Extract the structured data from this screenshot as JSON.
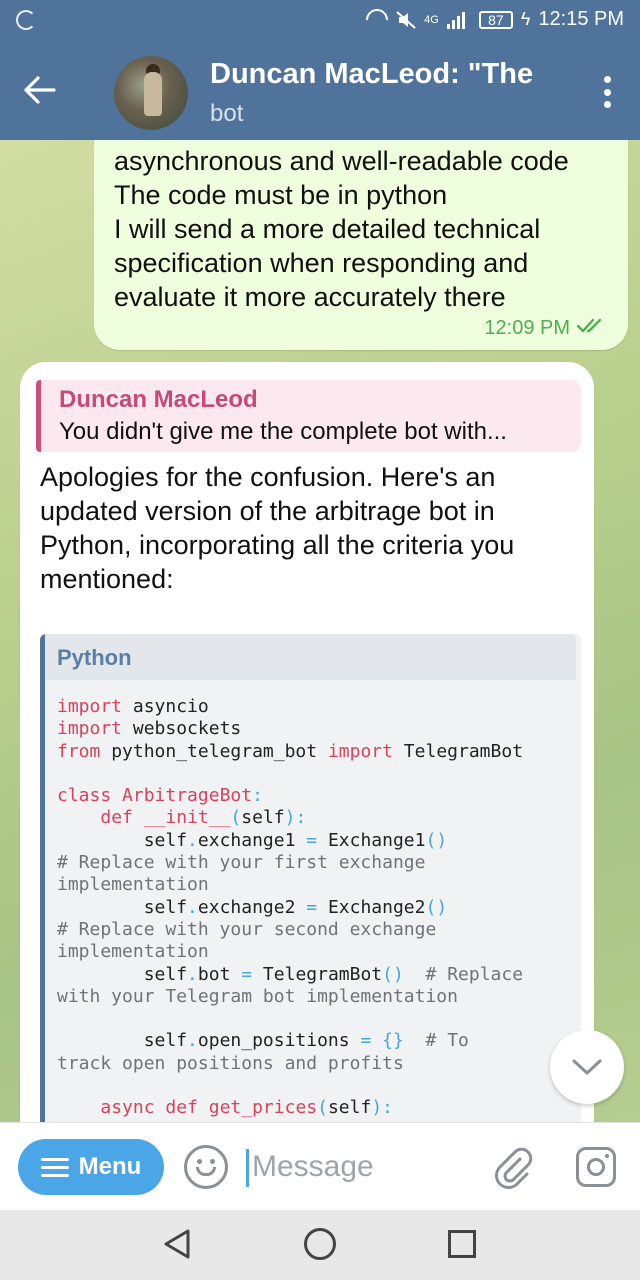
{
  "status_bar": {
    "network_label": "4G",
    "battery": "87",
    "time": "12:15 PM"
  },
  "header": {
    "title": "Duncan MacLeod: \"The",
    "subtitle": "bot",
    "icons": [
      "back-arrow-icon",
      "avatar",
      "more-vert-icon"
    ]
  },
  "outgoing_message": {
    "lines": [
      "asynchronous and well-readable code",
      "The code must be in python",
      "I will send a more detailed technical",
      "specification when responding and",
      "evaluate it more accurately there"
    ],
    "time": "12:09 PM",
    "read_status": "double-check-icon"
  },
  "incoming_message": {
    "reply_to": {
      "name": "Duncan MacLeod",
      "text": "You didn't give me the complete bot with..."
    },
    "lines": [
      "Apologies for the confusion. Here's an",
      "updated version of the arbitrage bot in",
      "Python, incorporating all the criteria you",
      "mentioned:"
    ],
    "code_language": "Python",
    "code_lines": [
      "import asyncio",
      "import websockets",
      "from python_telegram_bot import TelegramBot",
      "",
      "class ArbitrageBot:",
      "    def __init__(self):",
      "        self.exchange1 = Exchange1()",
      "# Replace with your first exchange",
      "implementation",
      "        self.exchange2 = Exchange2()",
      "# Replace with your second exchange",
      "implementation",
      "        self.bot = TelegramBot()  # Replace",
      "with your Telegram bot implementation",
      "",
      "        self.open_positions = {}  # To",
      "track open positions and profits",
      "",
      "    async def get_prices(self):"
    ]
  },
  "composer": {
    "menu_label": "Menu",
    "placeholder": "Message"
  },
  "colors": {
    "header": "#50739b",
    "accent": "#4aa6e6",
    "outgoing_bubble": "#efffde",
    "reply_name": "#c44a78",
    "code_keyword": "#d7425b"
  }
}
